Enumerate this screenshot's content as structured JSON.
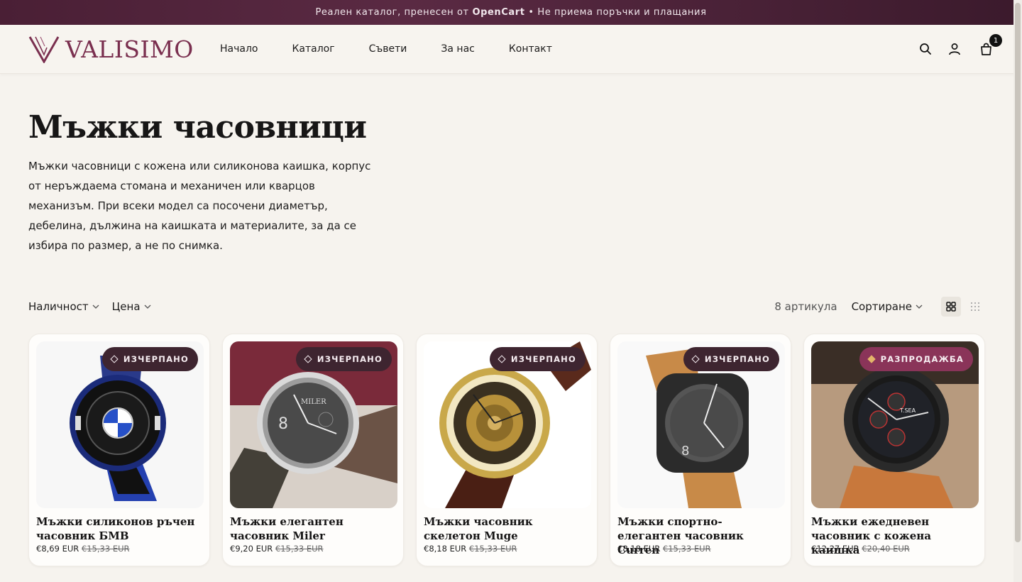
{
  "topbar": {
    "text_before": "Реален каталог, пренесен от ",
    "brand": "OpenCart",
    "text_after": " • Не приема поръчки и плащания"
  },
  "header": {
    "logo_text": "VALISIMO",
    "nav": [
      {
        "label": "Начало"
      },
      {
        "label": "Каталог"
      },
      {
        "label": "Съвети"
      },
      {
        "label": "За нас"
      },
      {
        "label": "Контакт"
      }
    ],
    "cart_count": "1"
  },
  "hero": {
    "title": "Мъжки часовници",
    "description": "Мъжки часовници с кожена или силиконова каишка, корпус от неръждаема стомана и механичен или кварцов механизъм. При всеки модел са посочени диаметър, дебелина, дължина на каишката и материалите, за да се избира по размер, а не по снимка."
  },
  "toolbar": {
    "filters": [
      {
        "label": "Наличност"
      },
      {
        "label": "Цена"
      }
    ],
    "count": "8 артикула",
    "sort_label": "Сортиране"
  },
  "products": [
    {
      "name": "Мъжки силиконов ръчен часовник БМВ",
      "price": "€8,69 EUR",
      "old_price": "€15,33 EUR",
      "badge": "ИЗЧЕРПАНО",
      "badge_type": "soldout"
    },
    {
      "name": "Мъжки елегантен часовник Miler",
      "price": "€9,20 EUR",
      "old_price": "€15,33 EUR",
      "badge": "ИЗЧЕРПАНО",
      "badge_type": "soldout"
    },
    {
      "name": "Мъжки часовник скелетон Muge",
      "price": "€8,18 EUR",
      "old_price": "€15,33 EUR",
      "badge": "ИЗЧЕРПАНО",
      "badge_type": "soldout"
    },
    {
      "name": "Мъжки спортно-елегантен часовник Curren",
      "price": "€8,18 EUR",
      "old_price": "€15,33 EUR",
      "badge": "ИЗЧЕРПАНО",
      "badge_type": "soldout"
    },
    {
      "name": "Мъжки ежедневен часовник с кожена каишка",
      "price": "€12,27 EUR",
      "old_price": "€20,40 EUR",
      "badge": "РАЗПРОДАЖБА",
      "badge_type": "sale"
    }
  ],
  "colors": {
    "brand": "#7a2f4f",
    "topbar": "#4a1f35",
    "badge": "#3e2530",
    "badge_sale": "#8a3459"
  }
}
